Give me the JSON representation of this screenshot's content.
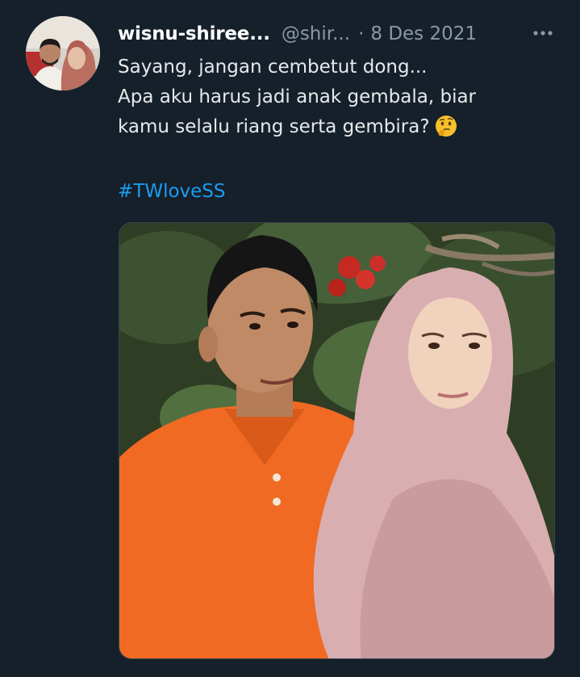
{
  "tweet": {
    "author_name": "wisnu-shiree...",
    "author_handle": "@shir...",
    "separator": "·",
    "date": "8 Des 2021",
    "text_lines": [
      "Sayang, jangan cembetut dong...",
      "Apa aku harus jadi anak gembala, biar",
      "kamu selalu riang serta gembira?"
    ],
    "hashtag": "#TWloveSS",
    "emoji": "thinking-face-icon",
    "more_icon": "more-horizontal-icon"
  },
  "colors": {
    "background": "#15202b",
    "primary_text": "#e7e9ea",
    "secondary_text": "#8b98a5",
    "link": "#1d9bf0",
    "border": "#38444d"
  }
}
